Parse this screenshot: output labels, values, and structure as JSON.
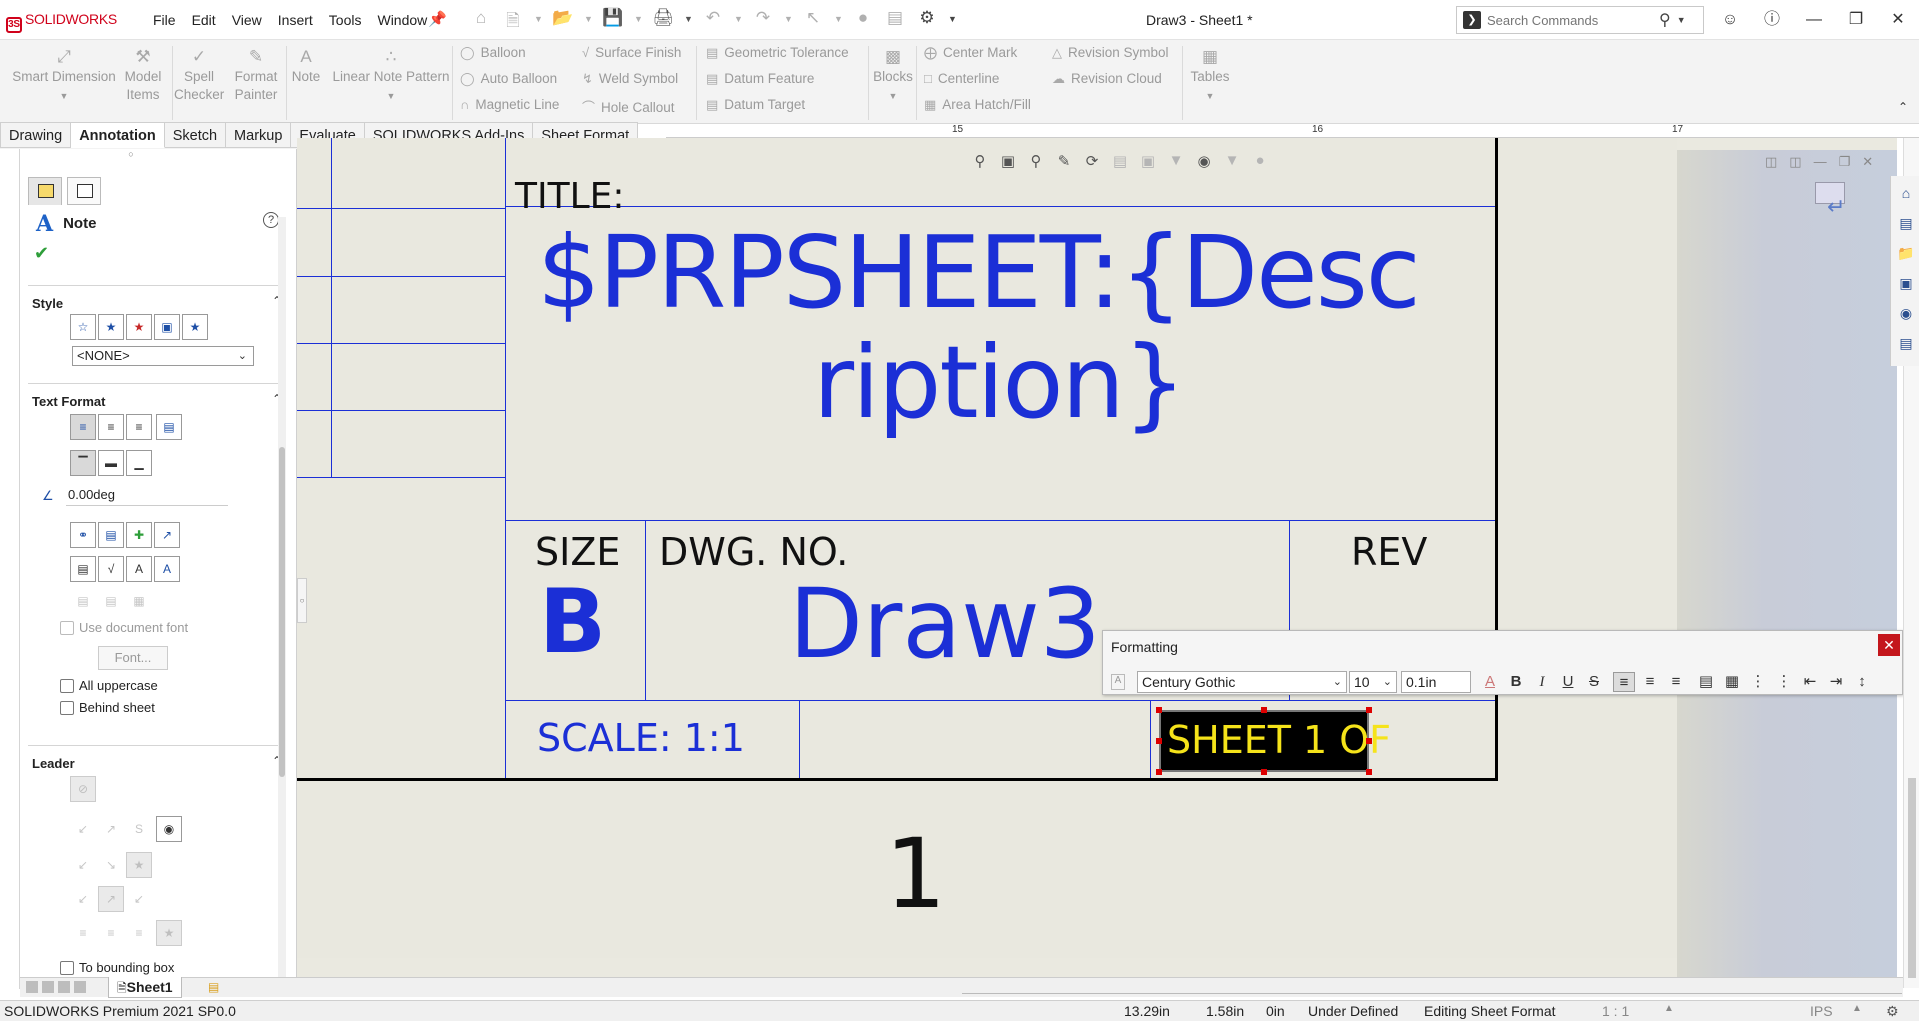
{
  "app": {
    "logo_ds": "3S",
    "logo_text": "SOLIDWORKS",
    "doc_title": "Draw3 - Sheet1 *"
  },
  "menu": [
    "File",
    "Edit",
    "View",
    "Insert",
    "Tools",
    "Window"
  ],
  "search": {
    "placeholder": "Search Commands"
  },
  "ribbon": {
    "large": [
      {
        "label1": "Smart Dimension",
        "label2": ""
      },
      {
        "label1": "Model",
        "label2": "Items"
      },
      {
        "label1": "Spell",
        "label2": "Checker"
      },
      {
        "label1": "Format",
        "label2": "Painter"
      },
      {
        "label1": "Note",
        "label2": ""
      },
      {
        "label1": "Linear Note Pattern",
        "label2": ""
      }
    ],
    "small": [
      "Balloon",
      "Auto Balloon",
      "Magnetic Line",
      "Surface Finish",
      "Weld Symbol",
      "Hole Callout",
      "Geometric Tolerance",
      "Datum Feature",
      "Datum Target",
      "Center Mark",
      "Centerline",
      "Area Hatch/Fill",
      "Revision Symbol",
      "Revision Cloud"
    ],
    "blocks_label": "Blocks",
    "tables_label": "Tables"
  },
  "tabs": [
    "Drawing",
    "Annotation",
    "Sketch",
    "Markup",
    "Evaluate",
    "SOLIDWORKS Add-Ins",
    "Sheet Format"
  ],
  "ruler": [
    "15",
    "16",
    "17"
  ],
  "property_manager": {
    "title": "Note",
    "help": "?",
    "sections": {
      "style": "Style",
      "text_format": "Text Format",
      "leader": "Leader"
    },
    "style_select": "<NONE>",
    "angle_value": "0.00deg",
    "use_doc_font": "Use document font",
    "font_button": "Font...",
    "all_uppercase": "All uppercase",
    "behind_sheet": "Behind sheet",
    "to_bounding_box": "To bounding box"
  },
  "drawing": {
    "title_label": "TITLE:",
    "title_value_line1": "$PRPSHEET:{Desc",
    "title_value_line2": "ription}",
    "size_label": "SIZE",
    "size_value": "B",
    "dwg_label": "DWG.  NO.",
    "dwg_value": "Draw3",
    "rev_label": "REV",
    "scale": "SCALE: 1:1",
    "sheet": "SHEET 1 OF",
    "below_number": "1"
  },
  "formatting": {
    "title": "Formatting",
    "font": "Century Gothic",
    "size": "10",
    "height": "0.1in"
  },
  "sheet_tab": "Sheet1",
  "status": {
    "product": "SOLIDWORKS Premium 2021 SP0.0",
    "x": "13.29in",
    "y": "1.58in",
    "z": "0in",
    "state": "Under Defined",
    "editing": "Editing Sheet Format",
    "scale": "1 : 1",
    "units": "IPS"
  },
  "colors": {
    "drawing_blue": "#1b2fd6",
    "sheet_bg": "#e9e8df",
    "selected_note_bg": "#000000",
    "selected_note_text": "#f5e31a"
  }
}
